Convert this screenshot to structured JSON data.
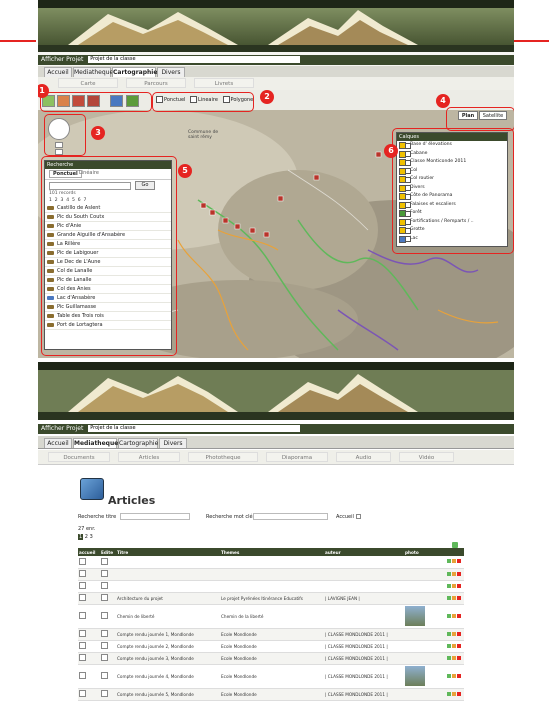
{
  "top": {
    "project_label": "Afficher Projet",
    "project_value": "Projet de la classe",
    "tabs": [
      "Accueil",
      "Mediatheque",
      "Cartographie",
      "Divers"
    ],
    "subtabs": [
      "Carte",
      "Parcours",
      "Livrets"
    ],
    "overlay_checks": [
      "Ponctuel",
      "Lineaire",
      "Polygone"
    ],
    "map_type_buttons": [
      "Plan",
      "Satellite"
    ],
    "callouts": [
      "1",
      "2",
      "3",
      "4",
      "5",
      "6"
    ],
    "map_label_commune": "Commune de\nsaint rémy",
    "search_panel": {
      "title": "Recherche",
      "tabs": [
        "Ponctuel",
        "Linéaire"
      ],
      "go_button": "Go",
      "count_text": "101 records",
      "pages": [
        "1",
        "2",
        "3",
        "4",
        "5",
        "6",
        "7"
      ],
      "items": [
        "Castillo de Aslent",
        "Pic du South Coutx",
        "Pic d'Anie",
        "Grande Aiguille d'Ansabère",
        "La Rillère",
        "Pic de Labigouer",
        "Le Dec de L'Aune",
        "Col de Lanalle",
        "Pic de Lanalle",
        "Col des Anies",
        "Lac d'Ansabère",
        "Pic Guillamasse",
        "Table des Trois rois",
        "Port de Lortagtera"
      ]
    },
    "layers_panel": {
      "title": "Calques",
      "items": [
        "Base d' élevations",
        "Cabane",
        "Classe Monticonde 2011",
        "Col",
        "Col routier",
        "Divers",
        "Côte de Panorama",
        "Falaises et escaliers",
        "Forêt",
        "Fortifications / Remparts / ..",
        "Grotte",
        "Lac"
      ]
    }
  },
  "bottom": {
    "project_label": "Afficher Projet",
    "project_value": "Projet de la classe",
    "tabs": [
      "Accueil",
      "Mediatheque",
      "Cartographie",
      "Divers"
    ],
    "subtabs": [
      "Documents",
      "Articles",
      "Phototheque",
      "Diaporama",
      "Audio",
      "Vidéo"
    ],
    "page_title": "Articles",
    "search_title_label": "Recherche titre",
    "search_word_label": "Recherche mot clé",
    "accueil_label": "Accueil",
    "count_text": "27 enr.",
    "pages": [
      "1",
      "2",
      "3"
    ],
    "columns": [
      "accueil",
      "Edite",
      "Titre",
      "Themes",
      "auteur",
      "photo"
    ],
    "rows": [
      {
        "titre": "",
        "theme": "",
        "auteur": "",
        "photo": false
      },
      {
        "titre": "",
        "theme": "",
        "auteur": "",
        "photo": false
      },
      {
        "titre": "",
        "theme": "",
        "auteur": "",
        "photo": false
      },
      {
        "titre": "Architecture du projet",
        "theme": "Le projet Pyrénées Itinérance Educatifs",
        "auteur": "| LAVIGNE JEAN |",
        "photo": false
      },
      {
        "titre": "Chemin de liberté",
        "theme": "Chemin de la liberté",
        "auteur": "",
        "photo": true
      },
      {
        "titre": "Compte rendu journée 1, Mondlonde",
        "theme": "Ecole Mondlonde",
        "auteur": "| CLASSE MONDLONDE 2011 |",
        "photo": false
      },
      {
        "titre": "Compte rendu journée 2, Mondlonde",
        "theme": "Ecole Mondlonde",
        "auteur": "| CLASSE MONDLONDE 2011 |",
        "photo": false
      },
      {
        "titre": "Compte rendu journée 3, Mondlonde",
        "theme": "Ecole Mondlonde",
        "auteur": "| CLASSE MONDLONDE 2011 |",
        "photo": false
      },
      {
        "titre": "Compte rendu journée 4, Mondlonde",
        "theme": "Ecole Mondlonde",
        "auteur": "| CLASSE MONDLONDE 2011 |",
        "photo": true
      },
      {
        "titre": "Compte rendu journée 5, Mondlonde",
        "theme": "Ecole Mondlonde",
        "auteur": "| CLASSE MONDLONDE 2011 |",
        "photo": false
      }
    ]
  },
  "colors": {
    "accent": "#e52421",
    "header_dark": "#3b4a2c",
    "route_green": "#5fb85a",
    "route_purple": "#7b55b5",
    "route_orange": "#e8a23a"
  }
}
